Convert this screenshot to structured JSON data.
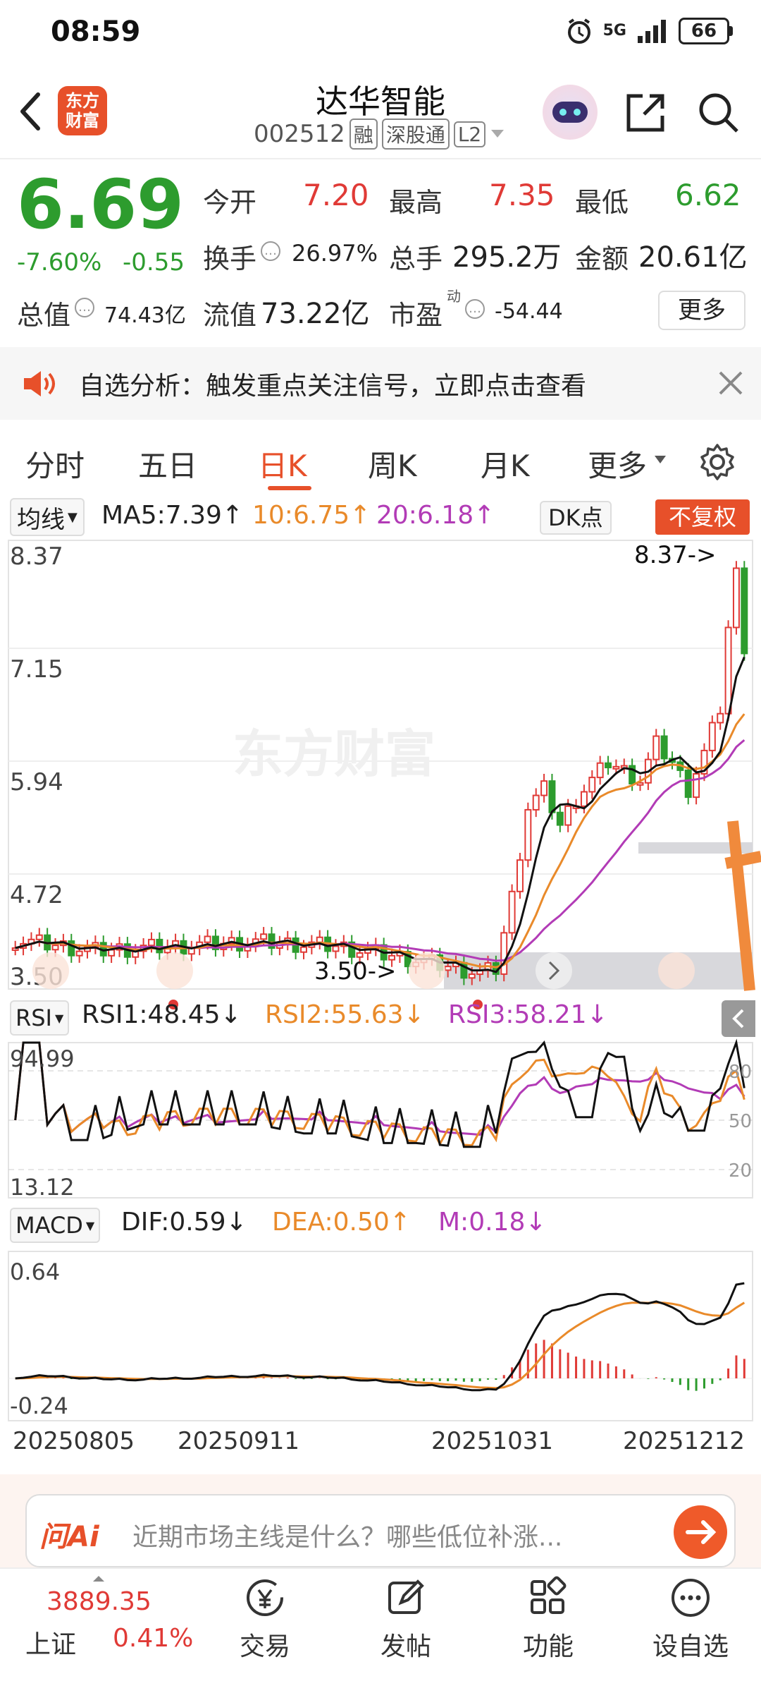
{
  "status": {
    "time": "08:59",
    "signal": "5G",
    "battery": "66"
  },
  "header": {
    "logo_line1": "东方",
    "logo_line2": "财富",
    "name": "达华智能",
    "code": "002512",
    "tags": [
      "融",
      "深股通",
      "L2"
    ]
  },
  "quote": {
    "price": "6.69",
    "change_pct": "-7.60%",
    "change": "-0.55",
    "open_label": "今开",
    "open": "7.20",
    "high_label": "最高",
    "high": "7.35",
    "low_label": "最低",
    "low": "6.62",
    "turnover_label": "换手",
    "turnover": "26.97%",
    "volume_label": "总手",
    "volume": "295.2万",
    "amount_label": "金额",
    "amount": "20.61亿",
    "mktcap_label": "总值",
    "mktcap": "74.43亿",
    "float_label": "流值",
    "float_cap": "73.22亿",
    "pe_label": "市盈",
    "pe_sup": "动",
    "pe": "-54.44",
    "more": "更多"
  },
  "notice": {
    "text": "自选分析：触发重点关注信号，立即点击查看"
  },
  "tabs": [
    "分时",
    "五日",
    "日K",
    "周K",
    "月K",
    "更多"
  ],
  "active_tab": "日K",
  "chart": {
    "ma_selector": "均线",
    "ma5": "MA5:7.39↑",
    "ma10": "10:6.75↑",
    "ma20": "20:6.18↑",
    "dk": "DK点",
    "adjust": "不复权",
    "price_ticks": [
      "8.37",
      "7.15",
      "5.94",
      "4.72",
      "3.50"
    ],
    "high_marker": "8.37->",
    "low_marker": "3.50->",
    "watermark": "东方财富",
    "rsi_selector": "RSI",
    "rsi1": "RSI1:48.45↓",
    "rsi2": "RSI2:55.63↓",
    "rsi3": "RSI3:58.21↓",
    "rsi_top": "94.99",
    "rsi_bottom": "13.12",
    "rsi_levels": [
      "80",
      "50",
      "20"
    ],
    "macd_selector": "MACD",
    "dif": "DIF:0.59↓",
    "dea": "DEA:0.50↑",
    "m": "M:0.18↓",
    "macd_top": "0.64",
    "macd_bottom": "-0.24",
    "dates": [
      "20250805",
      "20250911",
      "20251031",
      "20251212"
    ]
  },
  "colors": {
    "up": "#e03a36",
    "down": "#2d9c2e",
    "ma5": "#111111",
    "ma10": "#e98a2a",
    "ma20": "#b23bb6",
    "accent": "#e7502a"
  },
  "ask": {
    "brand": "问Ai",
    "placeholder": "近期市场主线是什么？哪些低位补涨..."
  },
  "bottom": {
    "index_value": "3889.35",
    "index_name": "上证",
    "index_change": "0.41%",
    "items": [
      "交易",
      "发帖",
      "功能",
      "设自选"
    ]
  }
}
